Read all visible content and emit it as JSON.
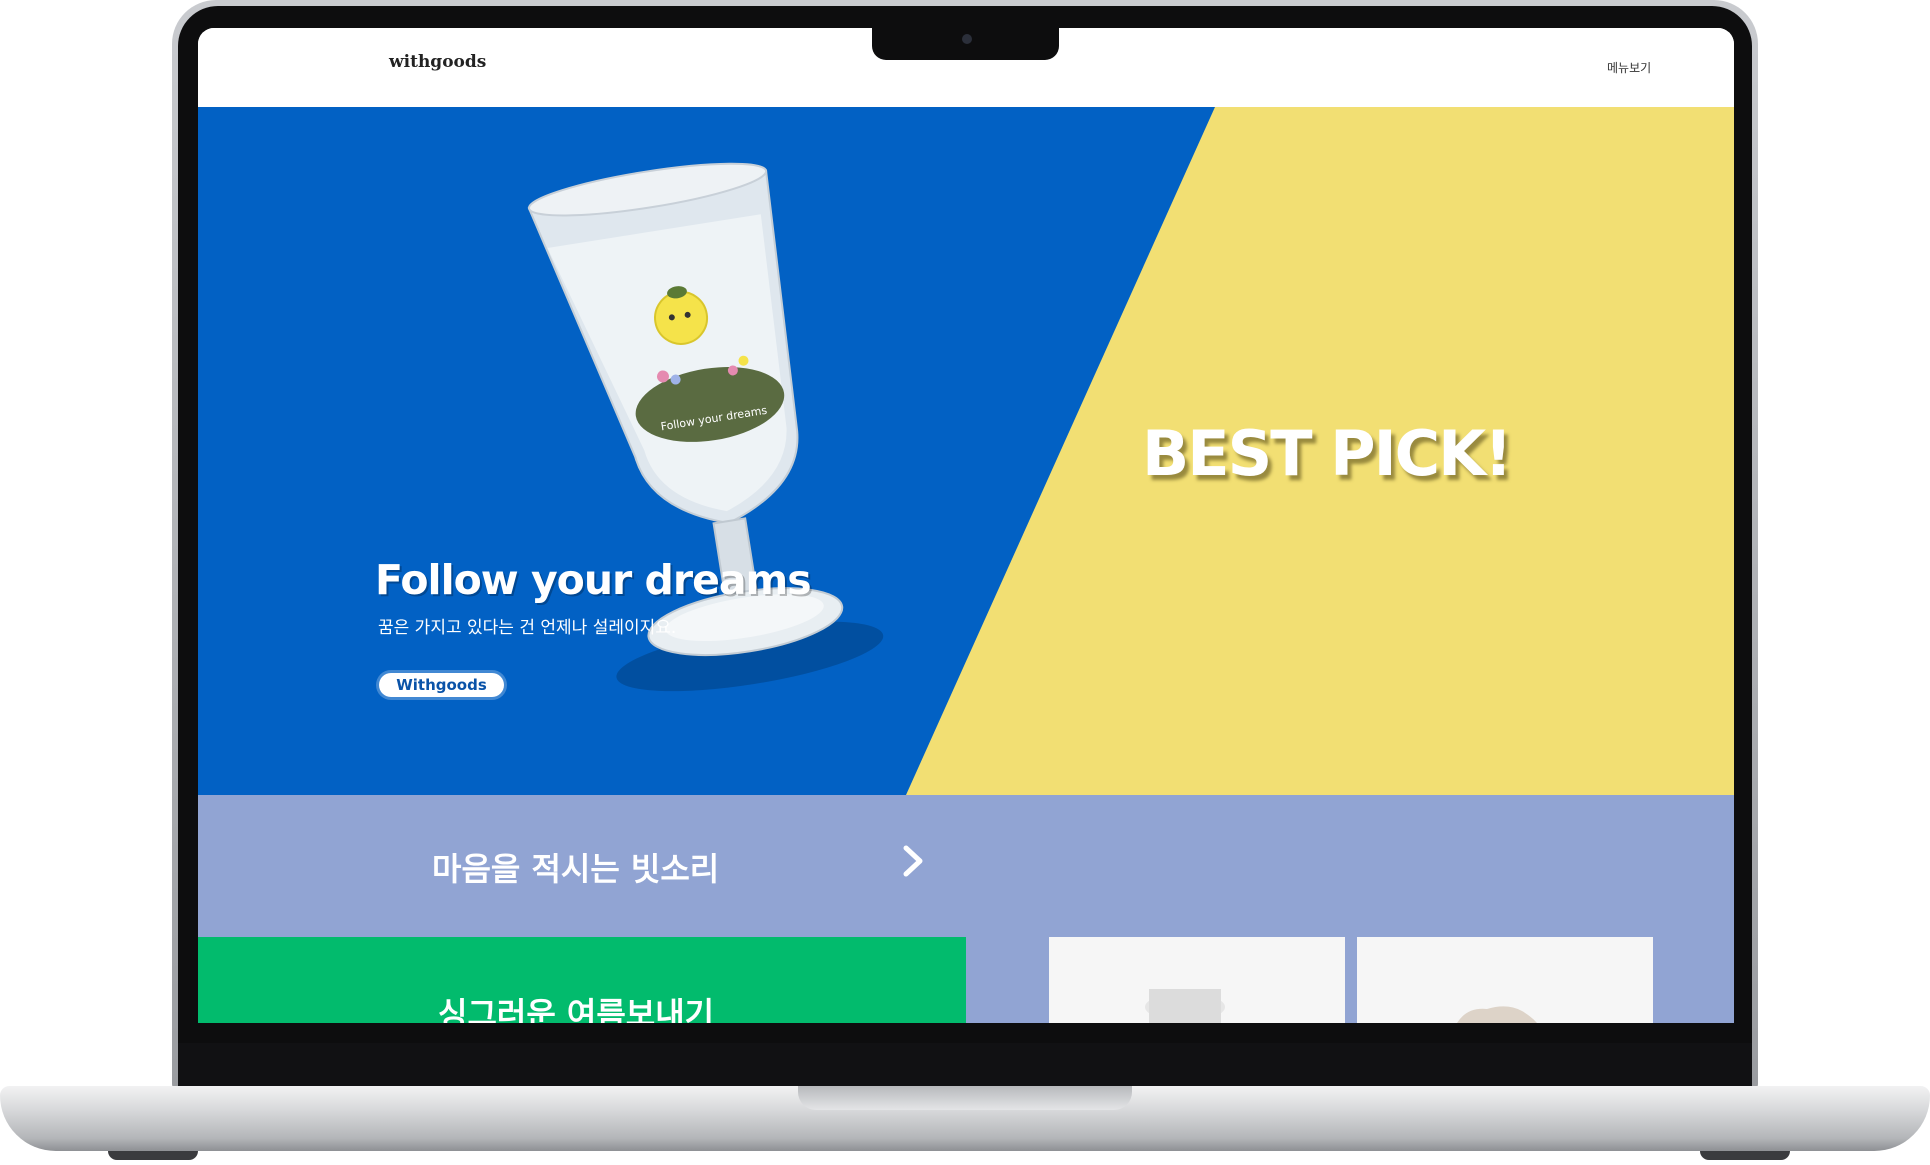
{
  "header": {
    "logo": "withgoods",
    "menu_label": "메뉴보기"
  },
  "hero": {
    "title": "Follow your dreams",
    "subtitle": "꿈은 가지고 있다는 건 언제나 설레이지요.",
    "button_label": "Withgoods",
    "glass_print_text": "Follow your dreams",
    "best_pick": "BEST PICK!",
    "colors": {
      "left": "#0261c4",
      "right": "#f2df73"
    }
  },
  "section2": {
    "title": "마음을 적시는 빗소리",
    "arrow_icon": "chevron-right-icon",
    "background": "#91a4d3",
    "green_card_title": "싱그러운 여름보내기",
    "green_card_color": "#02bb6d"
  }
}
